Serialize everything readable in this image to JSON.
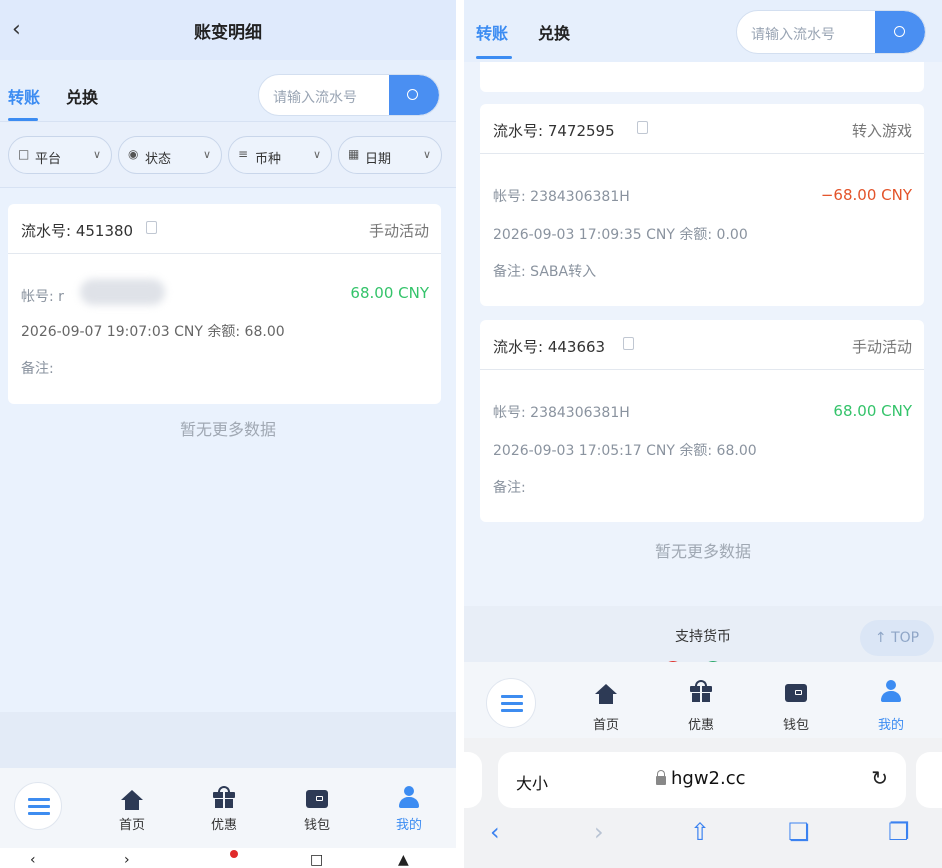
{
  "left": {
    "title": "账变明细",
    "tabs": [
      {
        "label": "转账",
        "active": true
      },
      {
        "label": "兑换",
        "active": false
      }
    ],
    "search": {
      "placeholder": "请输入流水号"
    },
    "filters": [
      {
        "label": "平台",
        "icon": "monitor-icon"
      },
      {
        "label": "状态",
        "icon": "clock-icon"
      },
      {
        "label": "币种",
        "icon": "coin-stack-icon"
      },
      {
        "label": "日期",
        "icon": "calendar-icon"
      }
    ],
    "record": {
      "serial": "流水号: 451380",
      "type": "手动活动",
      "account": "帐号: r",
      "amount": "68.00 CNY",
      "datetime_balance": "2026-09-07 19:07:03 CNY 余额: 68.00",
      "remark": "备注:"
    },
    "no_more": "暂无更多数据",
    "nav": [
      "首页",
      "优惠",
      "钱包",
      "我的"
    ]
  },
  "right": {
    "tabs": [
      {
        "label": "转账",
        "active": true
      },
      {
        "label": "兑换",
        "active": false
      }
    ],
    "search": {
      "placeholder": "请输入流水号"
    },
    "records": [
      {
        "serial": "流水号: 7472595",
        "type": "转入游戏",
        "account": "帐号: 2384306381H",
        "amount": "−68.00 CNY",
        "amount_color": "#e3532a",
        "datetime_balance": "2026-09-03 17:09:35 CNY 余额: 0.00",
        "remark": "备注: SABA转入"
      },
      {
        "serial": "流水号: 443663",
        "type": "手动活动",
        "account": "帐号: 2384306381H",
        "amount": "68.00 CNY",
        "amount_color": "#34c36a",
        "datetime_balance": "2026-09-03 17:05:17 CNY 余额: 68.00",
        "remark": "备注:"
      }
    ],
    "no_more": "暂无更多数据",
    "support_title": "支持货币",
    "top_button": "↑ TOP",
    "nav": [
      "首页",
      "优惠",
      "钱包",
      "我的"
    ],
    "browser": {
      "text_size": "大小",
      "url": "hgw2.cc"
    }
  },
  "colors": {
    "accent": "#3c8cf2",
    "positive": "#34c36a",
    "negative": "#e3532a"
  }
}
